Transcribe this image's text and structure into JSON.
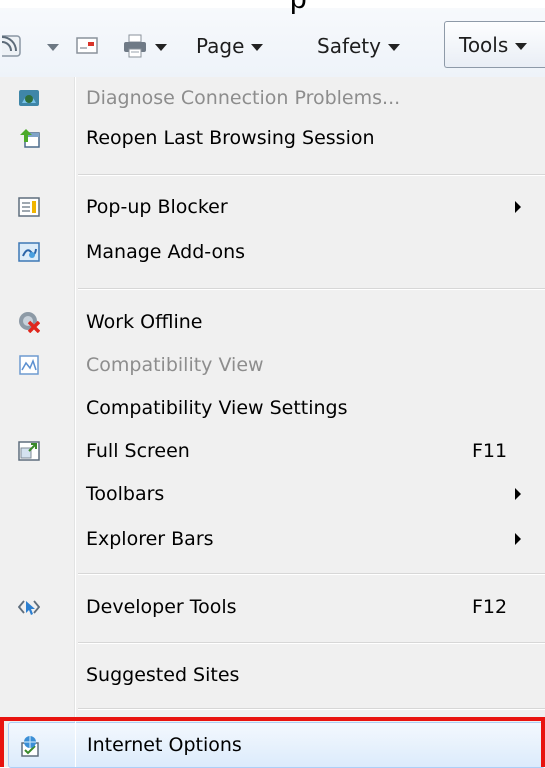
{
  "toolbar": {
    "page_label": "Page",
    "safety_label": "Safety",
    "tools_label": "Tools",
    "feed_icon": "rss-feed-icon",
    "read_mail_icon": "read-mail-icon",
    "print_icon": "print-icon"
  },
  "menu": {
    "items": [
      {
        "label": "Diagnose Connection Problems...",
        "icon": "diagnose-connection-icon",
        "disabled": true
      },
      {
        "label": "Reopen Last Browsing Session",
        "icon": "reopen-session-icon"
      },
      {
        "label": "Pop-up Blocker",
        "icon": "popup-blocker-icon",
        "submenu": true
      },
      {
        "label": "Manage Add-ons",
        "icon": "manage-addons-icon"
      },
      {
        "label": "Work Offline",
        "icon": "work-offline-icon"
      },
      {
        "label": "Compatibility View",
        "icon": "compatibility-view-icon",
        "disabled": true
      },
      {
        "label": "Compatibility View Settings"
      },
      {
        "label": "Full Screen",
        "icon": "full-screen-icon",
        "shortcut": "F11"
      },
      {
        "label": "Toolbars",
        "submenu": true
      },
      {
        "label": "Explorer Bars",
        "submenu": true
      },
      {
        "label": "Developer Tools",
        "icon": "developer-tools-icon",
        "shortcut": "F12"
      },
      {
        "label": "Suggested Sites"
      },
      {
        "label": "Internet Options",
        "icon": "internet-options-icon",
        "highlighted": true
      }
    ]
  },
  "colors": {
    "highlight_border": "#e8130f",
    "menu_background": "#f0f0f0",
    "disabled_text": "#8d8d8d"
  }
}
